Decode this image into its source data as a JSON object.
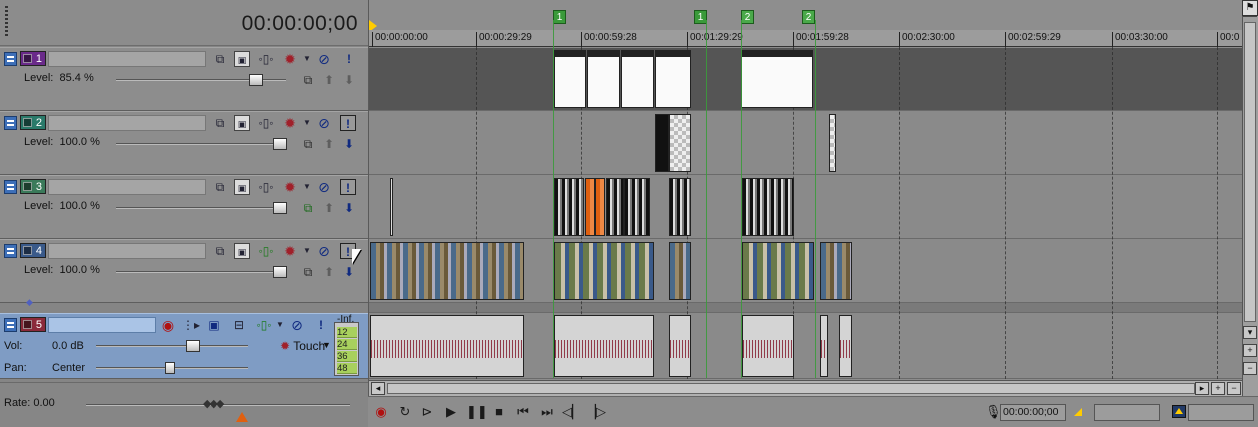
{
  "header": {
    "timecode": "00:00:00;00"
  },
  "tracks": [
    {
      "number": "1",
      "color": "#6a2a8a",
      "level_label": "Level:",
      "level_value": "85.4 %",
      "level_fraction": 0.854
    },
    {
      "number": "2",
      "color": "#2a7a6a",
      "level_label": "Level:",
      "level_value": "100.0 %",
      "level_fraction": 1.0
    },
    {
      "number": "3",
      "color": "#3a7a5a",
      "level_label": "Level:",
      "level_value": "100.0 %",
      "level_fraction": 1.0
    },
    {
      "number": "4",
      "color": "#3a5a8a",
      "level_label": "Level:",
      "level_value": "100.0 %",
      "level_fraction": 1.0
    }
  ],
  "audio_track": {
    "number": "5",
    "color": "#8a2a3a",
    "vol_label": "Vol:",
    "vol_value": "0.0 dB",
    "pan_label": "Pan:",
    "pan_value": "Center",
    "automation_mode": "Touch",
    "meter_inf": "-Inf.",
    "meter_marks": [
      "12",
      "24",
      "36",
      "48"
    ]
  },
  "rate": {
    "label": "Rate: 0.00"
  },
  "ruler": {
    "ticks": [
      "00:00:00:00",
      "00:00:29:29",
      "00:00:59:28",
      "00:01:29:29",
      "00:01:59:28",
      "00:02:30:00",
      "00:02:59:29",
      "00:03:30:00",
      "00:0"
    ]
  },
  "markers": [
    "1",
    "1",
    "2",
    "2"
  ],
  "transport": {
    "timecode": "00:00:00;00"
  },
  "icons": {
    "record": "record-icon",
    "loop": "loop-icon",
    "play-from-start": "play-from-start-icon",
    "play": "play-icon",
    "pause": "pause-icon",
    "stop": "stop-icon",
    "go-start": "go-to-start-icon",
    "go-end": "go-to-end-icon",
    "prev-frame": "previous-frame-icon",
    "next-frame": "next-frame-icon"
  }
}
